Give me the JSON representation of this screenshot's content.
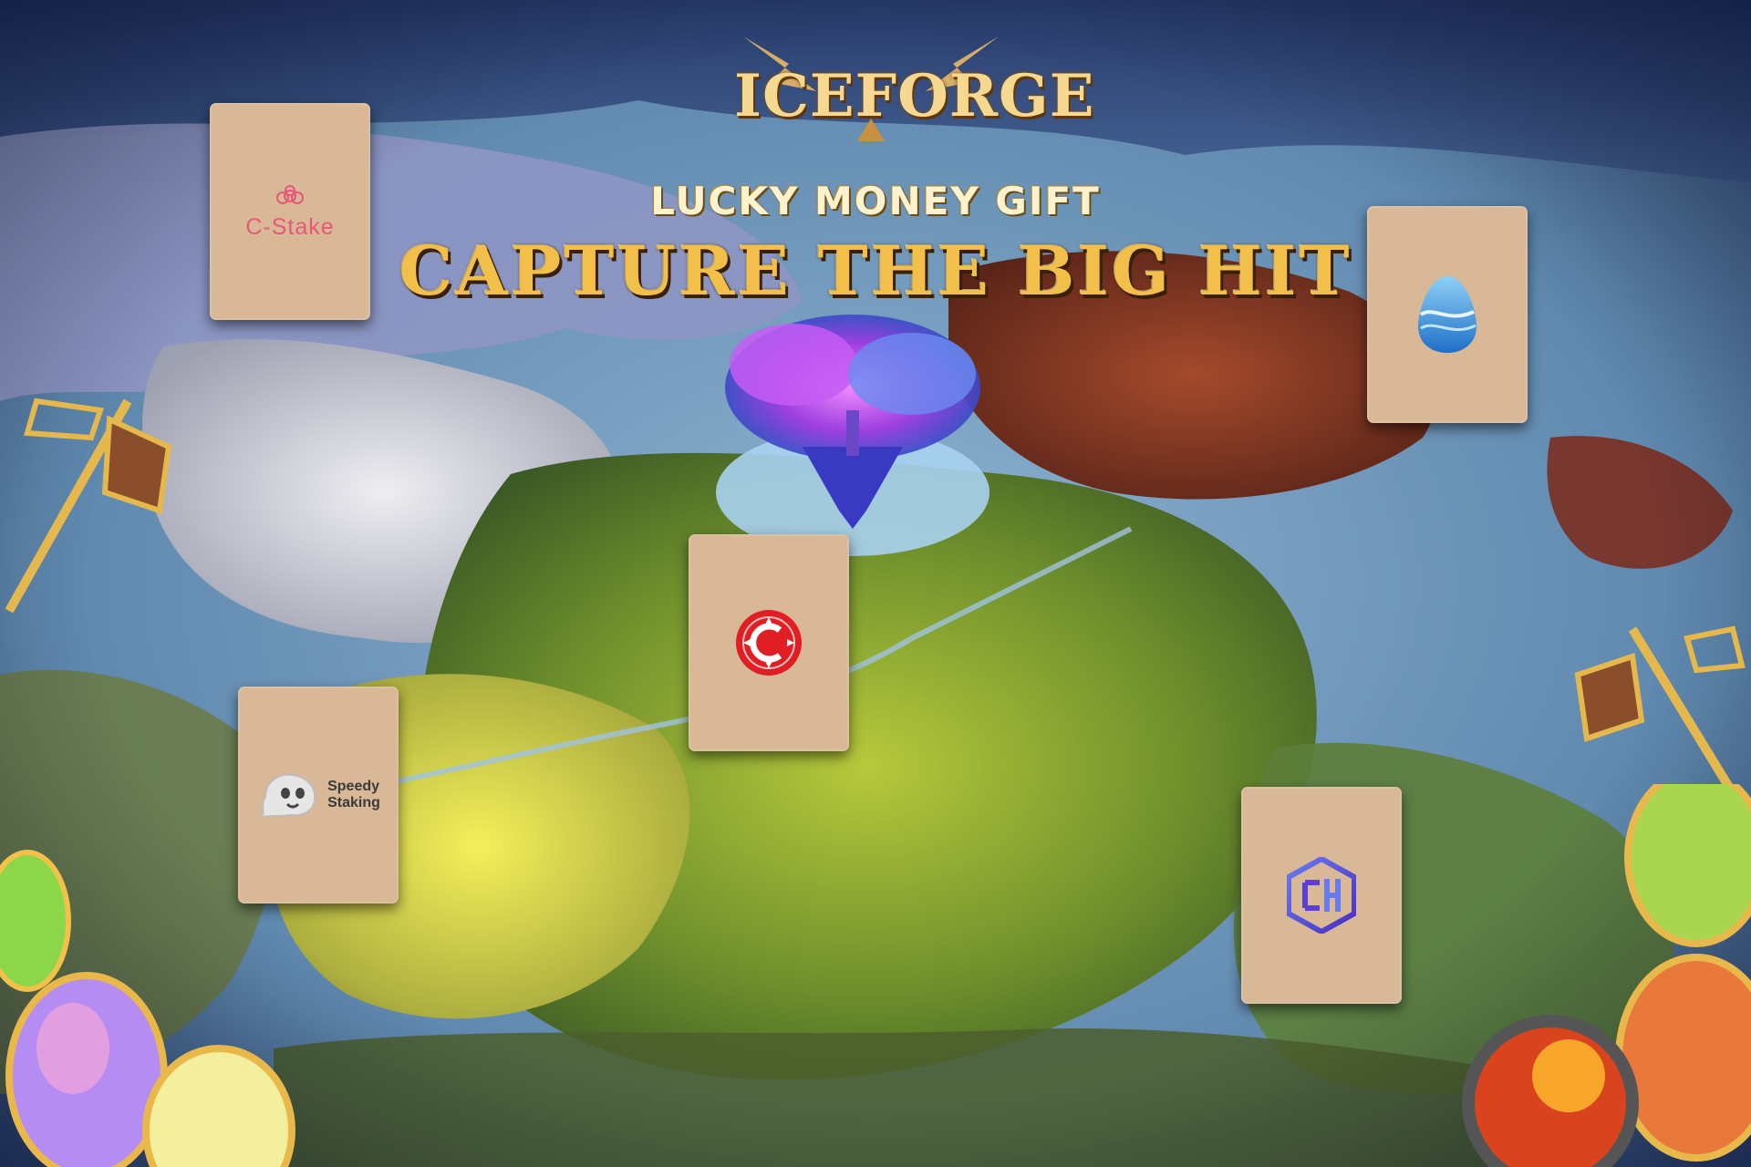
{
  "logo": {
    "text": "ICEFORGE",
    "icon": "iceforge-logo"
  },
  "banner": {
    "subtitle": "LUCKY MONEY GIFT",
    "headline": "CAPTURE THE BIG HIT"
  },
  "cards": [
    {
      "id": "c-stake",
      "label": "C-Stake",
      "icon": "c-stake-flower-icon",
      "color": "#e8577a"
    },
    {
      "id": "water-egg",
      "label": "",
      "icon": "blue-wave-egg-icon",
      "color": "#2f8fd8"
    },
    {
      "id": "red-coin",
      "label": "",
      "icon": "red-c-coin-icon",
      "color": "#e01e24"
    },
    {
      "id": "speedy-staking",
      "label": "Speedy\nStaking",
      "label_line1": "Speedy",
      "label_line2": "Staking",
      "icon": "ghost-icon",
      "color": "#3a3a3a"
    },
    {
      "id": "hex-logo",
      "label": "",
      "icon": "purple-hexagon-icon",
      "color": "#5b3fd6"
    }
  ],
  "colors": {
    "card_bg": "#d8b896",
    "title_gold": "#f2c04a",
    "ocean": "#6d98bd"
  }
}
